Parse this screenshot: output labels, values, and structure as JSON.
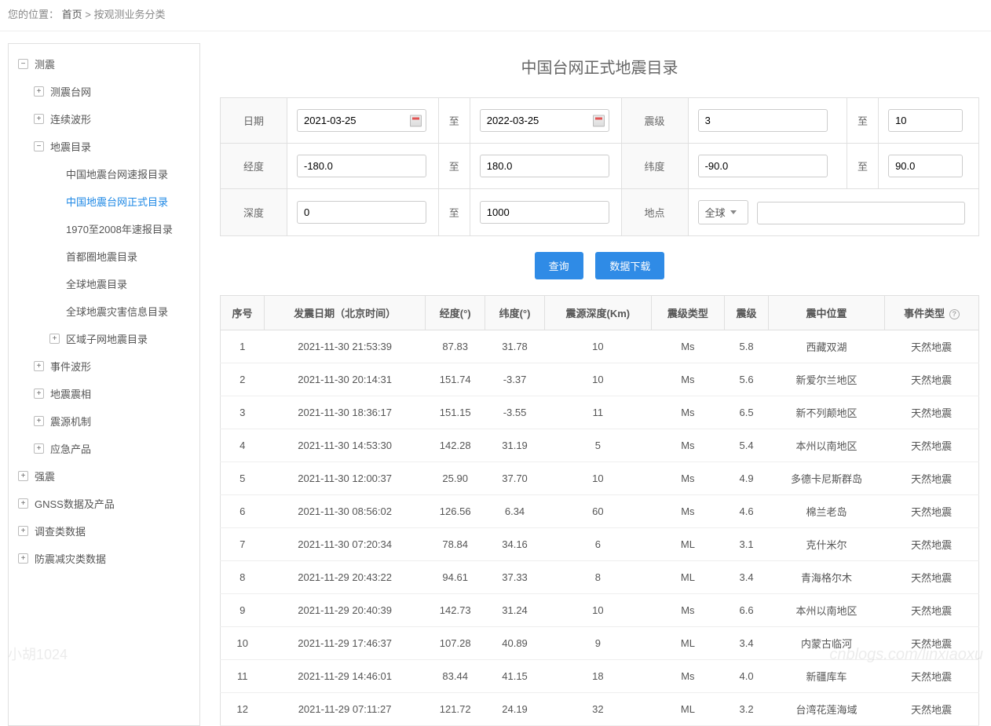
{
  "breadcrumb": {
    "label": "您的位置：",
    "home": "首页",
    "sep": ">",
    "current": "按观测业务分类"
  },
  "sidebar": {
    "root": {
      "label": "测震"
    },
    "items": [
      {
        "label": "测震台网",
        "toggle": "+"
      },
      {
        "label": "连续波形",
        "toggle": "+"
      },
      {
        "label": "地震目录",
        "toggle": "−",
        "children": [
          {
            "label": "中国地震台网速报目录"
          },
          {
            "label": "中国地震台网正式目录",
            "active": true
          },
          {
            "label": "1970至2008年速报目录"
          },
          {
            "label": "首都圈地震目录"
          },
          {
            "label": "全球地震目录"
          },
          {
            "label": "全球地震灾害信息目录"
          },
          {
            "label": "区域子网地震目录",
            "toggle": "+"
          }
        ]
      },
      {
        "label": "事件波形",
        "toggle": "+"
      },
      {
        "label": "地震震相",
        "toggle": "+"
      },
      {
        "label": "震源机制",
        "toggle": "+"
      },
      {
        "label": "应急产品",
        "toggle": "+"
      }
    ],
    "siblings": [
      {
        "label": "强震",
        "toggle": "+"
      },
      {
        "label": "GNSS数据及产品",
        "toggle": "+"
      },
      {
        "label": "调查类数据",
        "toggle": "+"
      },
      {
        "label": "防震减灾类数据",
        "toggle": "+"
      }
    ]
  },
  "page_title": "中国台网正式地震目录",
  "filters": {
    "date": {
      "label": "日期",
      "from": "2021-03-25",
      "sep": "至",
      "to": "2022-03-25"
    },
    "magnitude": {
      "label": "震级",
      "from": "3",
      "sep": "至",
      "to": "10"
    },
    "longitude": {
      "label": "经度",
      "from": "-180.0",
      "sep": "至",
      "to": "180.0"
    },
    "latitude": {
      "label": "纬度",
      "from": "-90.0",
      "sep": "至",
      "to": "90.0"
    },
    "depth": {
      "label": "深度",
      "from": "0",
      "sep": "至",
      "to": "1000"
    },
    "location": {
      "label": "地点",
      "select": "全球",
      "value": ""
    }
  },
  "buttons": {
    "query": "查询",
    "download": "数据下载"
  },
  "table": {
    "headers": [
      "序号",
      "发震日期（北京时间）",
      "经度(°)",
      "纬度(°)",
      "震源深度(Km)",
      "震级类型",
      "震级",
      "震中位置",
      "事件类型"
    ],
    "rows": [
      [
        "1",
        "2021-11-30 21:53:39",
        "87.83",
        "31.78",
        "10",
        "Ms",
        "5.8",
        "西藏双湖",
        "天然地震"
      ],
      [
        "2",
        "2021-11-30 20:14:31",
        "151.74",
        "-3.37",
        "10",
        "Ms",
        "5.6",
        "新爱尔兰地区",
        "天然地震"
      ],
      [
        "3",
        "2021-11-30 18:36:17",
        "151.15",
        "-3.55",
        "11",
        "Ms",
        "6.5",
        "新不列颠地区",
        "天然地震"
      ],
      [
        "4",
        "2021-11-30 14:53:30",
        "142.28",
        "31.19",
        "5",
        "Ms",
        "5.4",
        "本州以南地区",
        "天然地震"
      ],
      [
        "5",
        "2021-11-30 12:00:37",
        "25.90",
        "37.70",
        "10",
        "Ms",
        "4.9",
        "多德卡尼斯群岛",
        "天然地震"
      ],
      [
        "6",
        "2021-11-30 08:56:02",
        "126.56",
        "6.34",
        "60",
        "Ms",
        "4.6",
        "棉兰老岛",
        "天然地震"
      ],
      [
        "7",
        "2021-11-30 07:20:34",
        "78.84",
        "34.16",
        "6",
        "ML",
        "3.1",
        "克什米尔",
        "天然地震"
      ],
      [
        "8",
        "2021-11-29 20:43:22",
        "94.61",
        "37.33",
        "8",
        "ML",
        "3.4",
        "青海格尔木",
        "天然地震"
      ],
      [
        "9",
        "2021-11-29 20:40:39",
        "142.73",
        "31.24",
        "10",
        "Ms",
        "6.6",
        "本州以南地区",
        "天然地震"
      ],
      [
        "10",
        "2021-11-29 17:46:37",
        "107.28",
        "40.89",
        "9",
        "ML",
        "3.4",
        "内蒙古临河",
        "天然地震"
      ],
      [
        "11",
        "2021-11-29 14:46:01",
        "83.44",
        "41.15",
        "18",
        "Ms",
        "4.0",
        "新疆库车",
        "天然地震"
      ],
      [
        "12",
        "2021-11-29 07:11:27",
        "121.72",
        "24.19",
        "32",
        "ML",
        "3.2",
        "台湾花莲海域",
        "天然地震"
      ]
    ]
  },
  "watermark": {
    "left": "小胡1024",
    "right": "cnblogs.com/linxiaoxu"
  }
}
